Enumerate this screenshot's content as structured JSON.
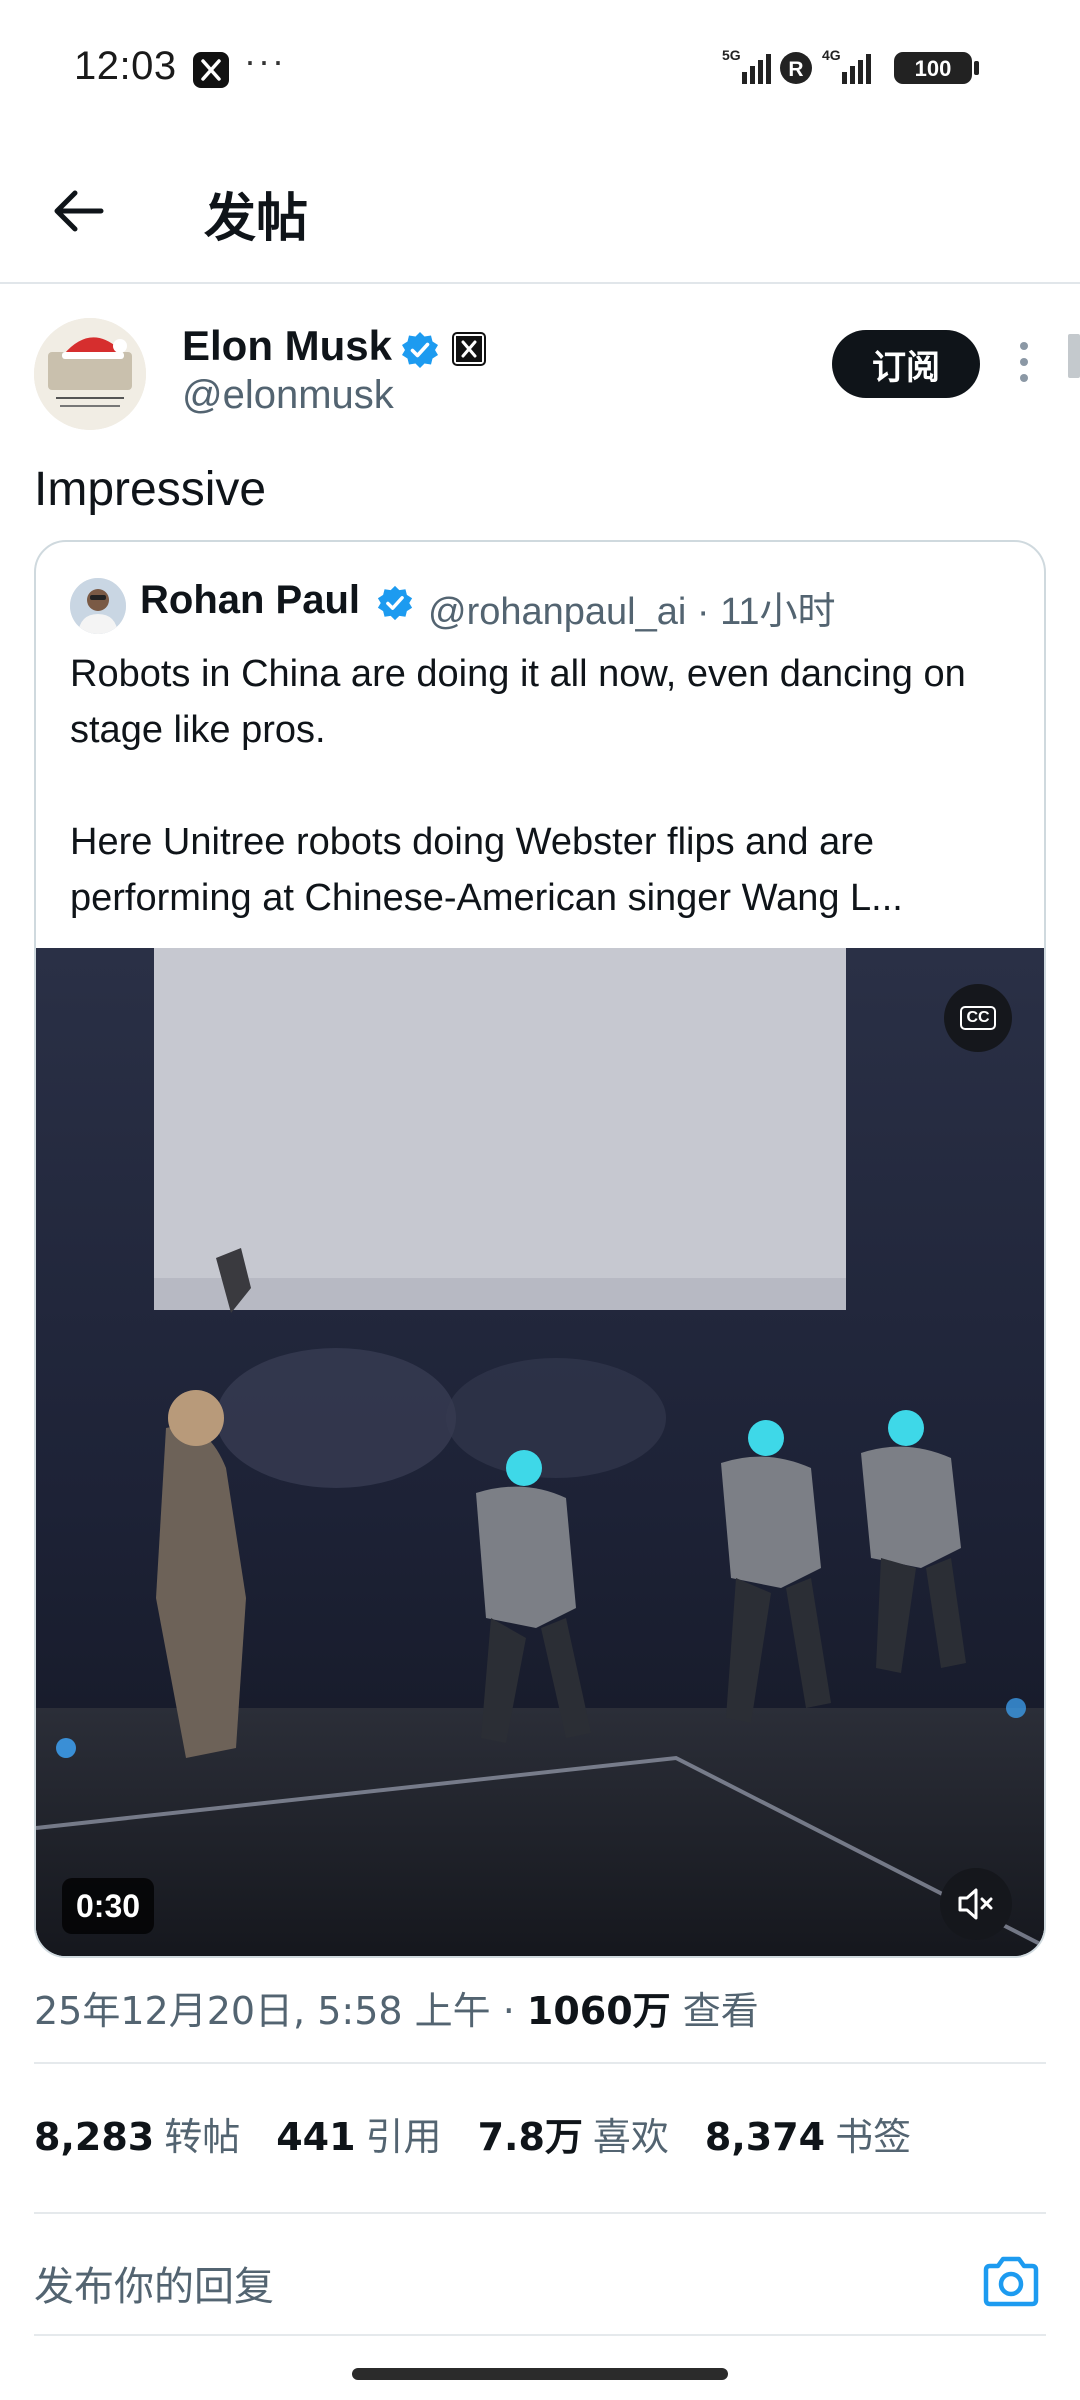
{
  "status_bar": {
    "time": "12:03",
    "more": "···",
    "network_1": "5G",
    "network_2": "4G",
    "roaming": "R",
    "battery": "100"
  },
  "header": {
    "title": "发帖"
  },
  "post": {
    "author_name": "Elon Musk",
    "author_handle": "@elonmusk",
    "subscribe_label": "订阅",
    "text": "Impressive"
  },
  "quote": {
    "author_name": "Rohan Paul",
    "author_handle": "@rohanpaul_ai · 11小时",
    "text_line1": "Robots in China are doing it all now, even dancing on stage like pros.",
    "text_line2": "Here Unitree robots doing Webster flips and are performing at Chinese-American singer Wang L...",
    "video_duration": "0:30",
    "cc_label": "CC"
  },
  "meta": {
    "timestamp": "25年12月20日, 5:58 上午 · ",
    "views_count": "1060万",
    "views_label": " 查看"
  },
  "stats": [
    {
      "count": "8,283",
      "label": "转帖"
    },
    {
      "count": "441",
      "label": "引用"
    },
    {
      "count": "7.8万",
      "label": "喜欢"
    },
    {
      "count": "8,374",
      "label": "书签"
    }
  ],
  "reply": {
    "placeholder": "发布你的回复"
  },
  "colors": {
    "verified": "#1d9bf0",
    "link_blue": "#1d9bf0",
    "text_primary": "#0f1419",
    "text_secondary": "#536471"
  },
  "icons": {
    "back": "arrow-left-icon",
    "verified": "verified-badge-icon",
    "x_affiliate": "x-logo-icon",
    "more": "more-vertical-icon",
    "cc": "closed-captions-icon",
    "mute": "volume-muted-icon",
    "camera": "camera-icon"
  }
}
